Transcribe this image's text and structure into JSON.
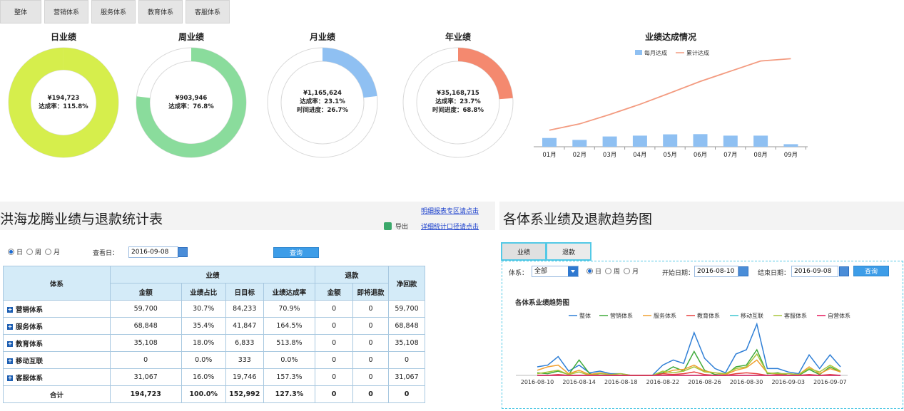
{
  "tabs": [
    "整体",
    "营销体系",
    "服务体系",
    "教育体系",
    "客服体系"
  ],
  "donuts": [
    {
      "title": "日业绩",
      "amount": "¥194,723",
      "rate": "达成率：115.8%",
      "progress": "",
      "fraction": 1.0,
      "color": "#d6ee4c"
    },
    {
      "title": "周业绩",
      "amount": "¥903,946",
      "rate": "达成率：76.8%",
      "progress": "",
      "fraction": 0.768,
      "color": "#8adc9c"
    },
    {
      "title": "月业绩",
      "amount": "¥1,165,624",
      "rate": "达成率：23.1%",
      "progress": "时间进度：26.7%",
      "fraction": 0.231,
      "color": "#8fc0f2"
    },
    {
      "title": "年业绩",
      "amount": "¥35,168,715",
      "rate": "达成率：23.7%",
      "progress": "时间进度：68.8%",
      "fraction": 0.237,
      "color": "#f4896f"
    }
  ],
  "monthly": {
    "title": "业绩达成情况",
    "legend_bar": "每月达成",
    "legend_line": "累计达成",
    "bar_color": "#8fc0f2",
    "line_color": "#f39b80",
    "chart_data": {
      "type": "bar",
      "categories": [
        "01月",
        "02月",
        "03月",
        "04月",
        "05月",
        "06月",
        "07月",
        "08月",
        "09月"
      ],
      "series": [
        {
          "name": "每月达成",
          "values": [
            4.1,
            3.2,
            4.8,
            5.2,
            5.8,
            5.9,
            5.2,
            5.2,
            1.2
          ]
        },
        {
          "name": "累计达成",
          "values": [
            4.1,
            7.3,
            12.1,
            17.3,
            23.1,
            29.0,
            34.2,
            39.4,
            40.6
          ]
        }
      ]
    }
  },
  "left": {
    "title": "洪海龙腾业绩与退款统计表",
    "link1": "明细报表专区请点击",
    "link2": "详细统计口径请点击",
    "export": "导出",
    "radio_options": [
      "日",
      "周",
      "月"
    ],
    "date_label": "查看日：",
    "date_value": "2016-09-08",
    "query": "查询",
    "table": {
      "h_system": "体系",
      "h_perf": "业绩",
      "h_refund": "退款",
      "h_net": "净回款",
      "subheaders": [
        "金额",
        "业绩占比",
        "日目标",
        "业绩达成率",
        "金额",
        "即将退款"
      ],
      "rows": [
        [
          "营销体系",
          "59,700",
          "30.7%",
          "84,233",
          "70.9%",
          "0",
          "0",
          "59,700"
        ],
        [
          "服务体系",
          "68,848",
          "35.4%",
          "41,847",
          "164.5%",
          "0",
          "0",
          "68,848"
        ],
        [
          "教育体系",
          "35,108",
          "18.0%",
          "6,833",
          "513.8%",
          "0",
          "0",
          "35,108"
        ],
        [
          "移动互联",
          "0",
          "0.0%",
          "333",
          "0.0%",
          "0",
          "0",
          "0"
        ],
        [
          "客服体系",
          "31,067",
          "16.0%",
          "19,746",
          "157.3%",
          "0",
          "0",
          "31,067"
        ]
      ],
      "total": [
        "合计",
        "194,723",
        "100.0%",
        "152,992",
        "127.3%",
        "0",
        "0",
        "0"
      ]
    }
  },
  "right": {
    "title": "各体系业绩及退款趋势图",
    "tabs": [
      "业绩",
      "退款"
    ],
    "system_label": "体系：",
    "system_value": "全部",
    "radio_options": [
      "日",
      "周",
      "月"
    ],
    "start_label": "开始日期：",
    "start_value": "2016-08-10",
    "end_label": "结束日期：",
    "end_value": "2016-09-08",
    "query": "查询",
    "chart_title": "各体系业绩趋势图",
    "chart_data": {
      "type": "line",
      "x_ticks": [
        "2016-08-10",
        "2016-08-14",
        "2016-08-18",
        "2016-08-22",
        "2016-08-26",
        "2016-08-30",
        "2016-09-03",
        "2016-09-07"
      ],
      "series": [
        {
          "name": "整体",
          "color": "#2f7fd6",
          "values": [
            10,
            12,
            22,
            5,
            12,
            3,
            5,
            2,
            2,
            0,
            0,
            0,
            12,
            18,
            14,
            50,
            20,
            8,
            3,
            25,
            30,
            60,
            8,
            8,
            4,
            2,
            24,
            8,
            24,
            10
          ]
        },
        {
          "name": "营销体系",
          "color": "#3faa3a",
          "values": [
            3,
            2,
            5,
            1,
            18,
            2,
            0,
            0,
            0,
            0,
            0,
            0,
            3,
            10,
            5,
            28,
            6,
            1,
            0,
            10,
            12,
            30,
            2,
            3,
            0,
            0,
            7,
            1,
            10,
            4
          ]
        },
        {
          "name": "服务体系",
          "color": "#f0a030",
          "values": [
            6,
            10,
            12,
            2,
            6,
            1,
            3,
            1,
            0,
            0,
            0,
            0,
            2,
            6,
            7,
            12,
            5,
            3,
            1,
            6,
            9,
            18,
            3,
            2,
            2,
            1,
            10,
            2,
            8,
            4
          ]
        },
        {
          "name": "教育体系",
          "color": "#e8413f",
          "values": [
            0,
            0,
            1,
            0,
            0,
            0,
            0,
            0,
            0,
            0,
            0,
            0,
            2,
            1,
            2,
            4,
            1,
            0,
            0,
            2,
            3,
            2,
            0,
            1,
            0,
            0,
            1,
            0,
            1,
            0
          ]
        },
        {
          "name": "移动互联",
          "color": "#3ec6d0",
          "values": [
            0,
            0,
            0,
            0,
            0,
            0,
            0,
            0,
            0,
            0,
            0,
            0,
            0,
            0,
            0,
            0,
            0,
            0,
            0,
            0,
            0,
            0,
            0,
            0,
            0,
            0,
            0,
            0,
            0,
            0
          ]
        },
        {
          "name": "客服体系",
          "color": "#a9c53a",
          "values": [
            2,
            4,
            6,
            1,
            4,
            0,
            2,
            1,
            2,
            0,
            0,
            0,
            5,
            3,
            5,
            10,
            4,
            3,
            2,
            8,
            10,
            25,
            3,
            2,
            2,
            1,
            8,
            4,
            12,
            5
          ]
        },
        {
          "name": "自营体系",
          "color": "#e6175a",
          "values": [
            0,
            0,
            0,
            0,
            0,
            0,
            0,
            0,
            0,
            0,
            0,
            0,
            0,
            0,
            0,
            0,
            0,
            0,
            0,
            0,
            0,
            0,
            0,
            0,
            0,
            0,
            0,
            0,
            0,
            0
          ]
        }
      ]
    }
  }
}
